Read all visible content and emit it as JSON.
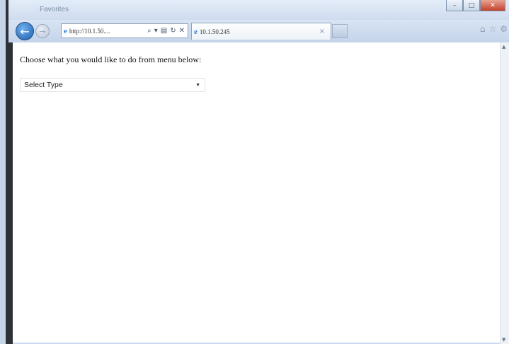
{
  "window": {
    "title": "Favorites",
    "caption": {
      "minimize": "–",
      "maximize": "□",
      "close": "✕"
    }
  },
  "navbar": {
    "back_icon": "back-arrow-icon",
    "forward_icon": "forward-arrow-icon",
    "address": "http://10.1.50....",
    "address_tools": {
      "search": "⌕",
      "dropdown": "▾",
      "compat": "▤",
      "refresh": "↻",
      "stop": "✕"
    },
    "tab_title": "10.1.50.245",
    "tab_close": "×"
  },
  "toolbar_icons": {
    "home": "⌂",
    "favorites": "☆",
    "tools": "⚙"
  },
  "page": {
    "prompt": "Choose what you would like to do from menu below:",
    "select": {
      "selected": "Select Type",
      "options": [
        "Select Type"
      ]
    }
  },
  "colors": {
    "ie_blue": "#2a78d6",
    "close_red": "#c2412a"
  }
}
